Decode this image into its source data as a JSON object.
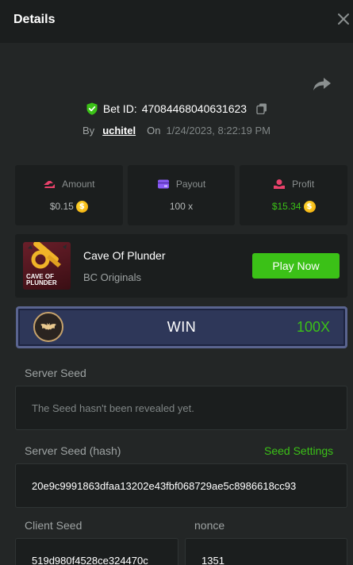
{
  "header": {
    "title": "Details"
  },
  "bet": {
    "id_label": "Bet ID:",
    "id_value": "47084468040631623",
    "by_label": "By",
    "user": "uchitel",
    "on_label": "On",
    "date": "1/24/2023, 8:22:19 PM"
  },
  "stats": {
    "amount": {
      "label": "Amount",
      "value": "$0.15"
    },
    "payout": {
      "label": "Payout",
      "value": "100 x"
    },
    "profit": {
      "label": "Profit",
      "value": "$15.34"
    }
  },
  "game": {
    "title": "Cave Of Plunder",
    "provider": "BC Originals",
    "thumb_text_1": "CAVE OF",
    "thumb_text_2": "PLUNDER",
    "play_label": "Play Now"
  },
  "result": {
    "label": "WIN",
    "multiplier": "100X"
  },
  "seeds": {
    "server_seed_label": "Server Seed",
    "server_seed_value": "The Seed hasn't been revealed yet.",
    "server_hash_label": "Server Seed (hash)",
    "seed_settings_label": "Seed Settings",
    "server_hash_value": "20e9c9991863dfaa13202e43fbf068729ae5c8986618cc93",
    "client_seed_label": "Client Seed",
    "client_seed_value": "519d980f4528ce324470c",
    "nonce_label": "nonce",
    "nonce_value": "1351"
  },
  "colors": {
    "accent_green": "#3bc117",
    "panel": "#1b1e1e",
    "background": "#232626"
  },
  "icons": [
    "close-icon",
    "share-icon",
    "shield-check-icon",
    "copy-icon",
    "amount-icon",
    "payout-icon",
    "profit-icon",
    "coin-icon",
    "medal-bat-icon"
  ]
}
